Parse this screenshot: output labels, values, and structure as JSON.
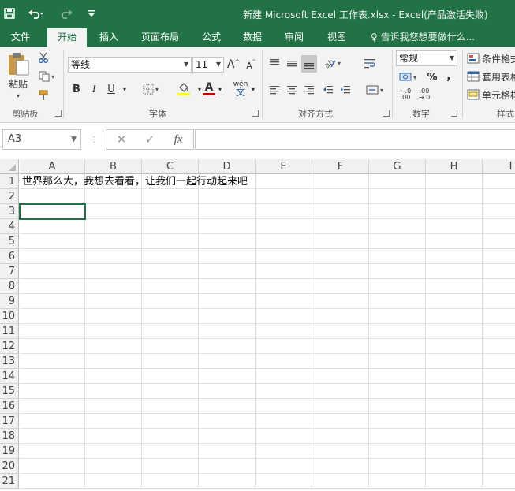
{
  "window": {
    "title": "新建 Microsoft Excel 工作表.xlsx - Excel(产品激活失败)"
  },
  "quick_access": {
    "save_icon": "save-icon",
    "undo_icon": "undo-icon",
    "redo_icon": "redo-icon",
    "customize_icon": "customize-icon"
  },
  "tabs": [
    {
      "label": "文件"
    },
    {
      "label": "开始",
      "active": true
    },
    {
      "label": "插入"
    },
    {
      "label": "页面布局"
    },
    {
      "label": "公式"
    },
    {
      "label": "数据"
    },
    {
      "label": "审阅"
    },
    {
      "label": "视图"
    }
  ],
  "tell_me": "告诉我您想要做什么...",
  "ribbon": {
    "clipboard": {
      "paste_label": "粘贴",
      "group_label": "剪贴板"
    },
    "font": {
      "font_name": "等线",
      "font_size": "11",
      "bold": "B",
      "italic": "I",
      "underline": "U",
      "grow": "A",
      "shrink": "A",
      "font_color_letter": "A",
      "phonetic_top": "wén",
      "phonetic_bottom": "文",
      "group_label": "字体"
    },
    "alignment": {
      "group_label": "对齐方式"
    },
    "number": {
      "format": "常规",
      "percent": "%",
      "comma": ",",
      "group_label": "数字"
    },
    "styles": {
      "conditional": "条件格式",
      "table": "套用表格",
      "cell": "单元格样",
      "group_label": "样式"
    }
  },
  "formula_bar": {
    "name_box": "A3",
    "fx_label": "fx",
    "formula": ""
  },
  "sheet": {
    "columns": [
      "A",
      "B",
      "C",
      "D",
      "E",
      "F",
      "G",
      "H",
      "I"
    ],
    "rows": [
      "1",
      "2",
      "3",
      "4",
      "5",
      "6",
      "7",
      "8",
      "9",
      "10",
      "11",
      "12",
      "13",
      "14",
      "15",
      "16",
      "17",
      "18",
      "19",
      "20",
      "21"
    ],
    "selected_cell": "A3",
    "cells": {
      "A1": "世界那么大，我想去看看，让我们一起行动起来吧"
    }
  },
  "colors": {
    "accent": "#217346",
    "font_color_bar": "#c00000",
    "fill_color_bar": "#ffff00"
  }
}
